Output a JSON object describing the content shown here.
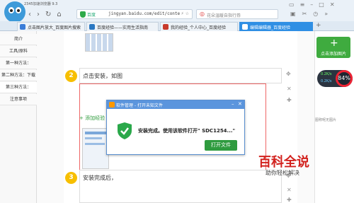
{
  "app": {
    "title": "2345加速浏览器 9.3"
  },
  "address": {
    "label": "百度",
    "url": "jingyan.baidu.com/edit/conte",
    "rss_icon": "rss-icon"
  },
  "search": {
    "placeholder": "花朵温暖自指行券"
  },
  "tabs": [
    {
      "label": "点击图片放大_百度图片搜索",
      "color": "#3b7dd8"
    },
    {
      "label": "百度经验——实用生活指南",
      "color": "#2b78c2"
    },
    {
      "label": "我的经验_个人中心_百度经验",
      "color": "#c83a2b"
    },
    {
      "label": "编辑编辑器_百度经验",
      "color": "#ffffff",
      "active": true
    }
  ],
  "leftnav": {
    "items": [
      "简介",
      "工具/原料",
      "第一种方法：",
      "第二种方法：下载",
      "第三种方法：",
      "注意事项"
    ]
  },
  "steps": [
    {
      "num": "2",
      "text": "点击安装，如图"
    },
    {
      "num": "3",
      "text": "安装完成后，"
    }
  ],
  "add_link_label": "+ 添加经验",
  "dialog": {
    "title": "软件管理 - 打开未知文件",
    "message": "安装完成。使用该软件打开\" SDC1254...\"",
    "button": "打开文件"
  },
  "rpanel": {
    "add_picture": "点击添加图片",
    "tip": "图称呢无图片"
  },
  "speed": {
    "up": "0.2K/s",
    "down": "0.2K/s",
    "percent": "84%"
  },
  "watermark": {
    "brand": "百科全说",
    "slogan": "助你轻松解决"
  },
  "colors": {
    "accent": "#2f8fe4",
    "step": "#f7bf00",
    "green": "#3fab3f",
    "red": "#d2211d"
  }
}
